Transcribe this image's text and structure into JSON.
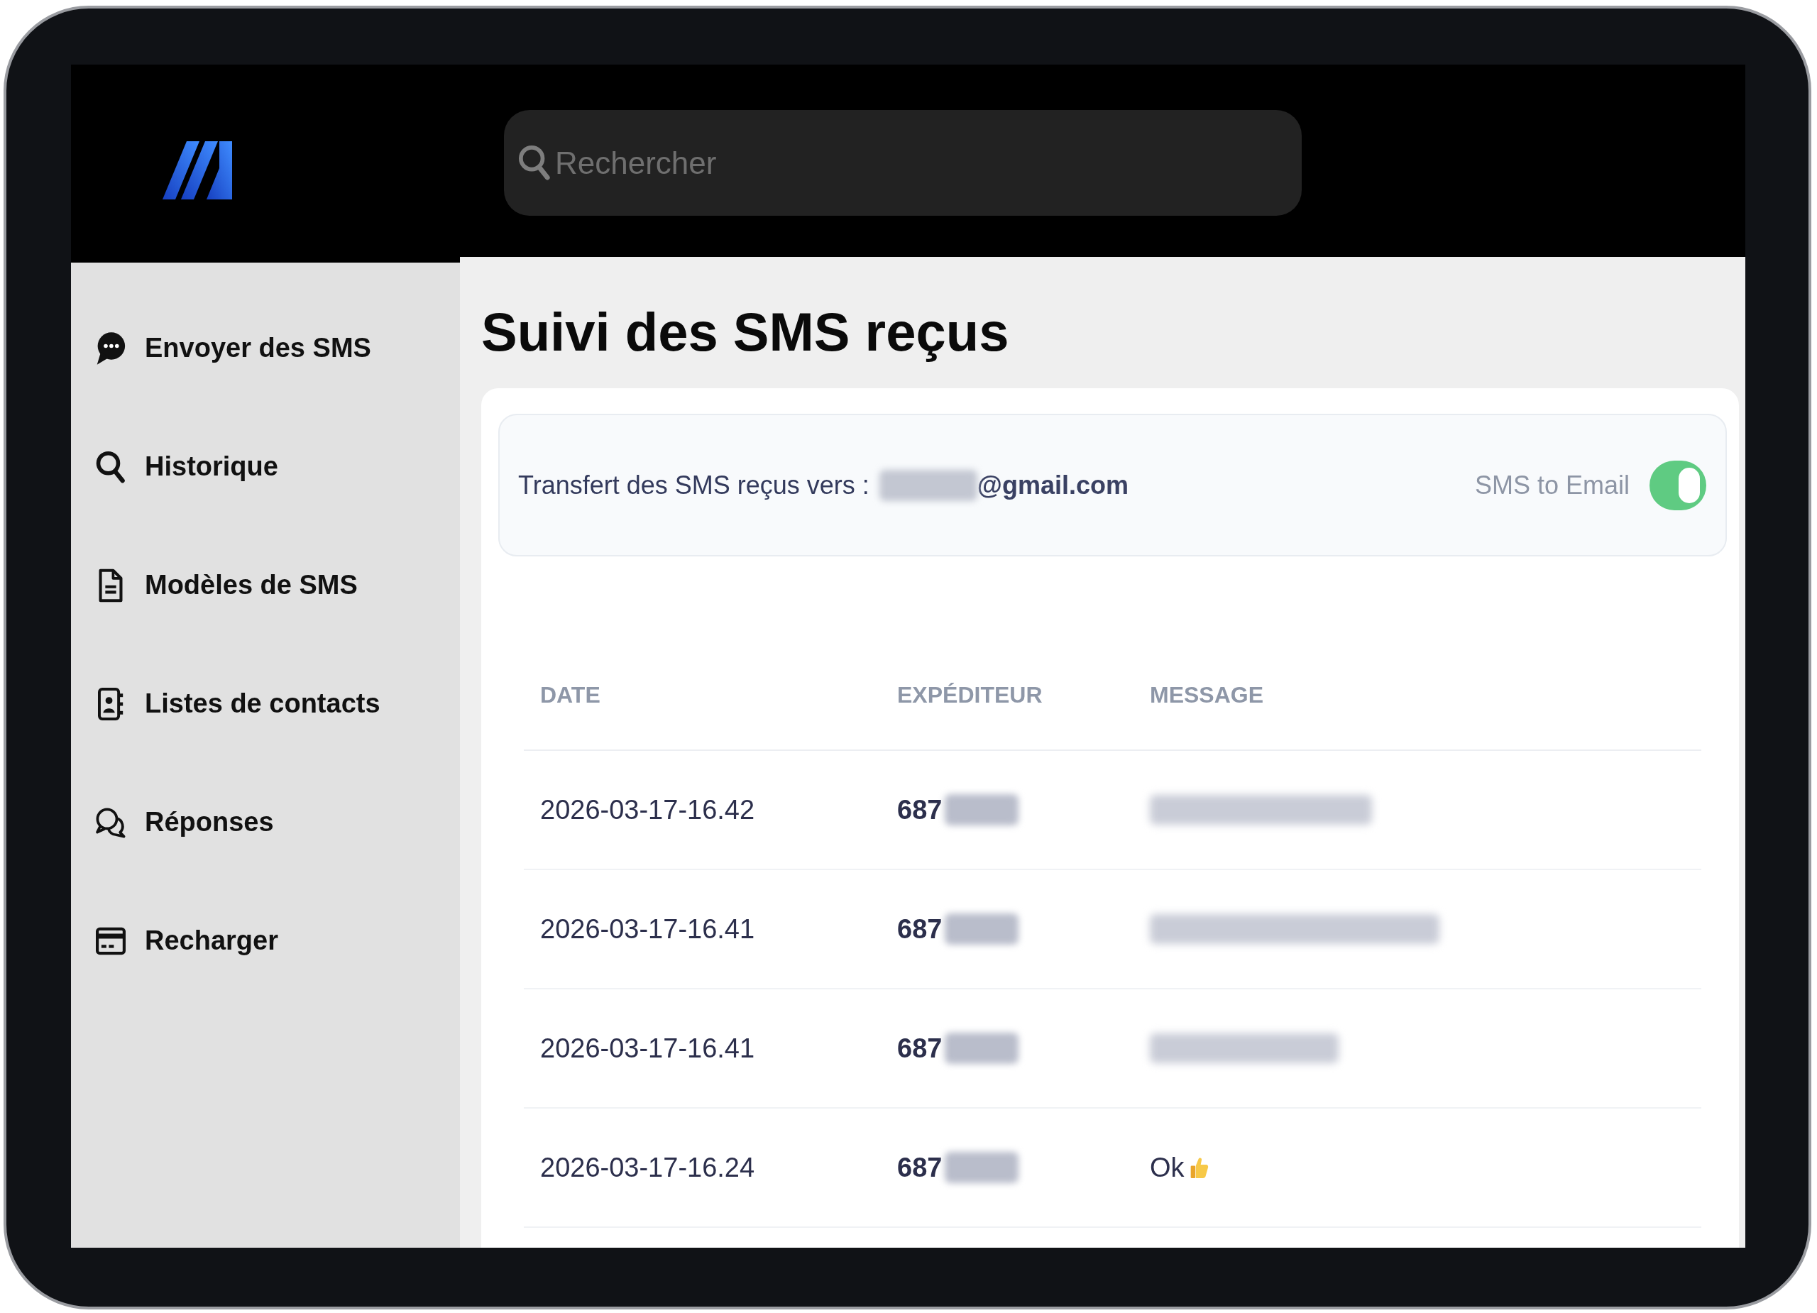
{
  "header": {
    "search": {
      "placeholder": "Rechercher"
    }
  },
  "sidebar": {
    "items": [
      {
        "label": "Envoyer des SMS",
        "kind": "send",
        "selected": false
      },
      {
        "label": "Historique",
        "kind": "history",
        "selected": false
      },
      {
        "label": "Modèles de SMS",
        "kind": "templates",
        "selected": false
      },
      {
        "label": "Listes de contacts",
        "kind": "contacts",
        "selected": false
      },
      {
        "label": "Réponses",
        "kind": "replies",
        "selected": false
      },
      {
        "label": "Recharger",
        "kind": "recharge",
        "selected": false
      }
    ]
  },
  "page": {
    "title": "Suivi des SMS reçus"
  },
  "forwarding": {
    "label": "Transfert des SMS reçus vers :",
    "email_blurred": true,
    "email": "@gmail.com",
    "toggle": {
      "label": "SMS to Email",
      "on": true
    }
  },
  "table": {
    "columns": [
      "DATE",
      "EXPÉDITEUR",
      "MESSAGE"
    ],
    "rows": [
      {
        "date": "2026-03-17-16.42",
        "sender": "687",
        "sender_blurred": true,
        "message": {
          "kind": "blurred"
        }
      },
      {
        "date": "2026-03-17-16.41",
        "sender": "687",
        "sender_blurred": true,
        "message": {
          "kind": "blurred"
        }
      },
      {
        "date": "2026-03-17-16.41",
        "sender": "687",
        "sender_blurred": true,
        "message": {
          "kind": "blurred"
        }
      },
      {
        "date": "2026-03-17-16.24",
        "sender": "687",
        "sender_blurred": true,
        "message": {
          "kind": "text",
          "text": "Ok",
          "emoji": true
        }
      }
    ]
  }
}
